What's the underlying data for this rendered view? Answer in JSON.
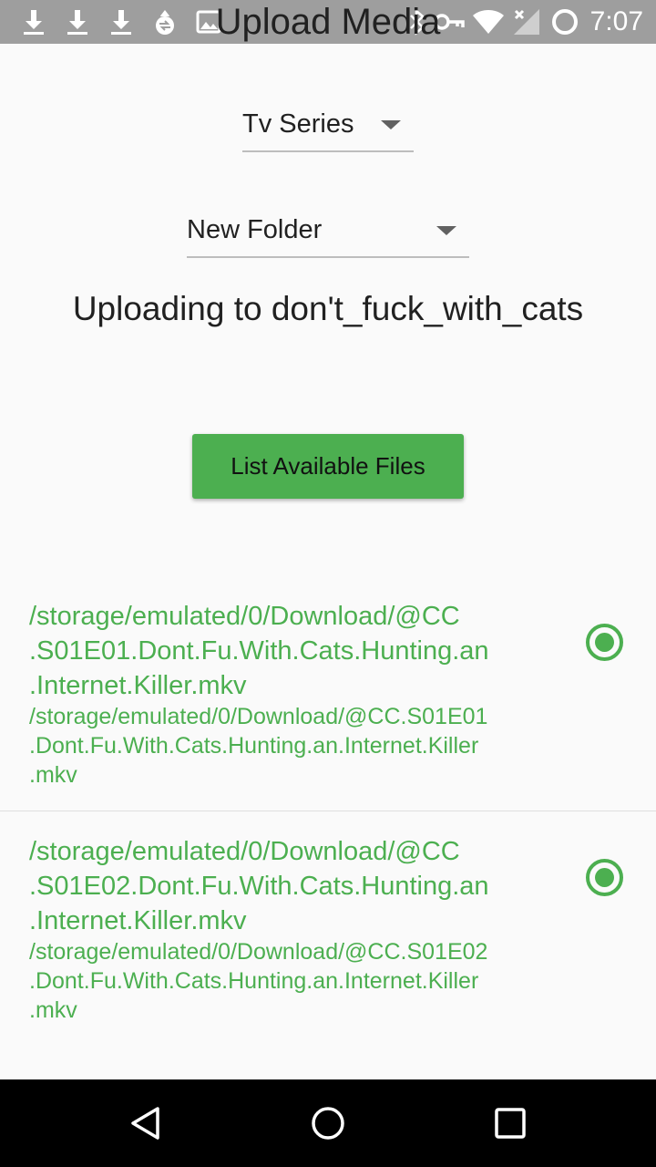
{
  "status_bar": {
    "time": "7:07",
    "icons": [
      "download-icon",
      "download-icon",
      "download-icon",
      "sync-icon",
      "image-icon",
      "bluetooth-icon",
      "vpn-key-icon",
      "wifi-icon",
      "signal-icon",
      "battery-icon"
    ]
  },
  "app_title": "Upload Media",
  "series_dropdown": {
    "selected": "Tv Series"
  },
  "folder_dropdown": {
    "selected": "New Folder"
  },
  "upload_target": "Uploading to don't_fuck_with_cats",
  "list_button_label": "List Available Files",
  "files": [
    {
      "title_lines": [
        "/storage/emulated/0/Download/@CC",
        ".S01E01.Dont.Fu.With.Cats.Hunting.an",
        ".Internet.Killer.mkv"
      ],
      "subtitle_lines": [
        "/storage/emulated/0/Download/@CC.S01E01",
        ".Dont.Fu.With.Cats.Hunting.an.Internet.Killer",
        ".mkv"
      ],
      "selected": true
    },
    {
      "title_lines": [
        "/storage/emulated/0/Download/@CC",
        ".S01E02.Dont.Fu.With.Cats.Hunting.an",
        ".Internet.Killer.mkv"
      ],
      "subtitle_lines": [
        "/storage/emulated/0/Download/@CC.S01E02",
        ".Dont.Fu.With.Cats.Hunting.an.Internet.Killer",
        ".mkv"
      ],
      "selected": true
    }
  ],
  "nav_bar": {
    "icons": [
      "back-icon",
      "home-icon",
      "recents-icon"
    ]
  },
  "colors": {
    "accent": "#4caf50",
    "status_bar": "#9e9e9e",
    "nav_bar": "#000000",
    "background": "#fafafa"
  }
}
